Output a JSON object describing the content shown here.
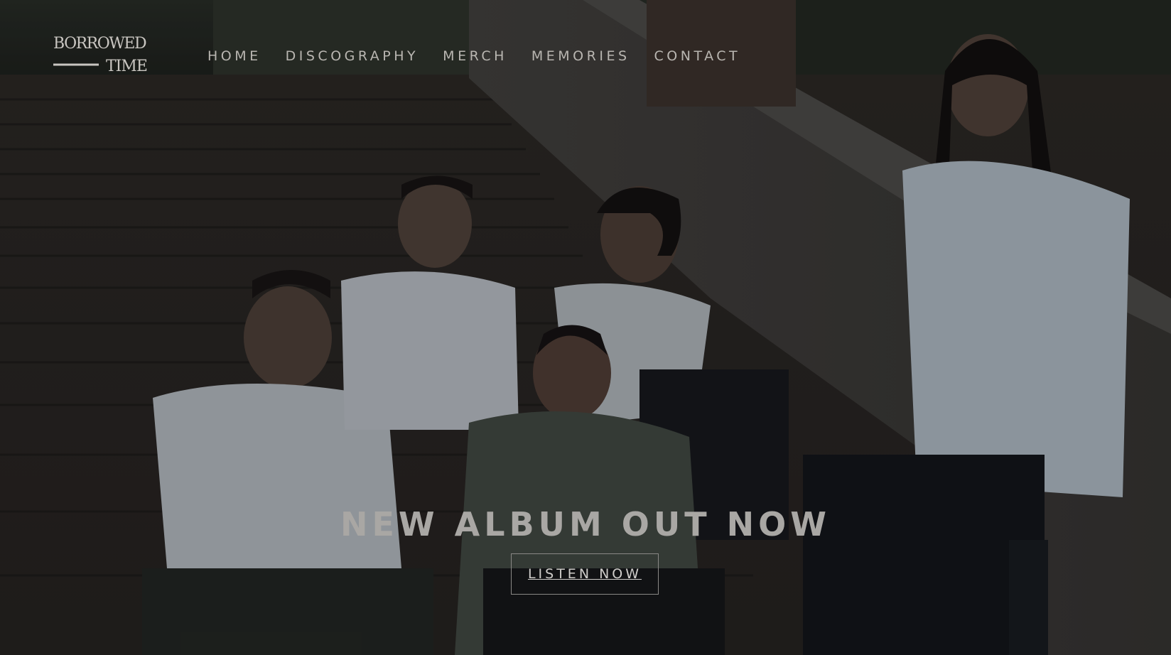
{
  "brand": {
    "logo_line1": "BORROWED",
    "logo_line2": "TIME"
  },
  "nav": {
    "items": [
      {
        "label": "HOME"
      },
      {
        "label": "DISCOGRAPHY"
      },
      {
        "label": "MERCH"
      },
      {
        "label": "MEMORIES"
      },
      {
        "label": "CONTACT"
      }
    ]
  },
  "hero": {
    "headline": "NEW ALBUM OUT NOW",
    "cta_label": "LISTEN NOW"
  },
  "colors": {
    "nav_text": "#b9b6b1",
    "headline_text": "#a9a7a4",
    "button_border": "#8a8886"
  },
  "icons": [
    "borrowed-time-logo"
  ]
}
